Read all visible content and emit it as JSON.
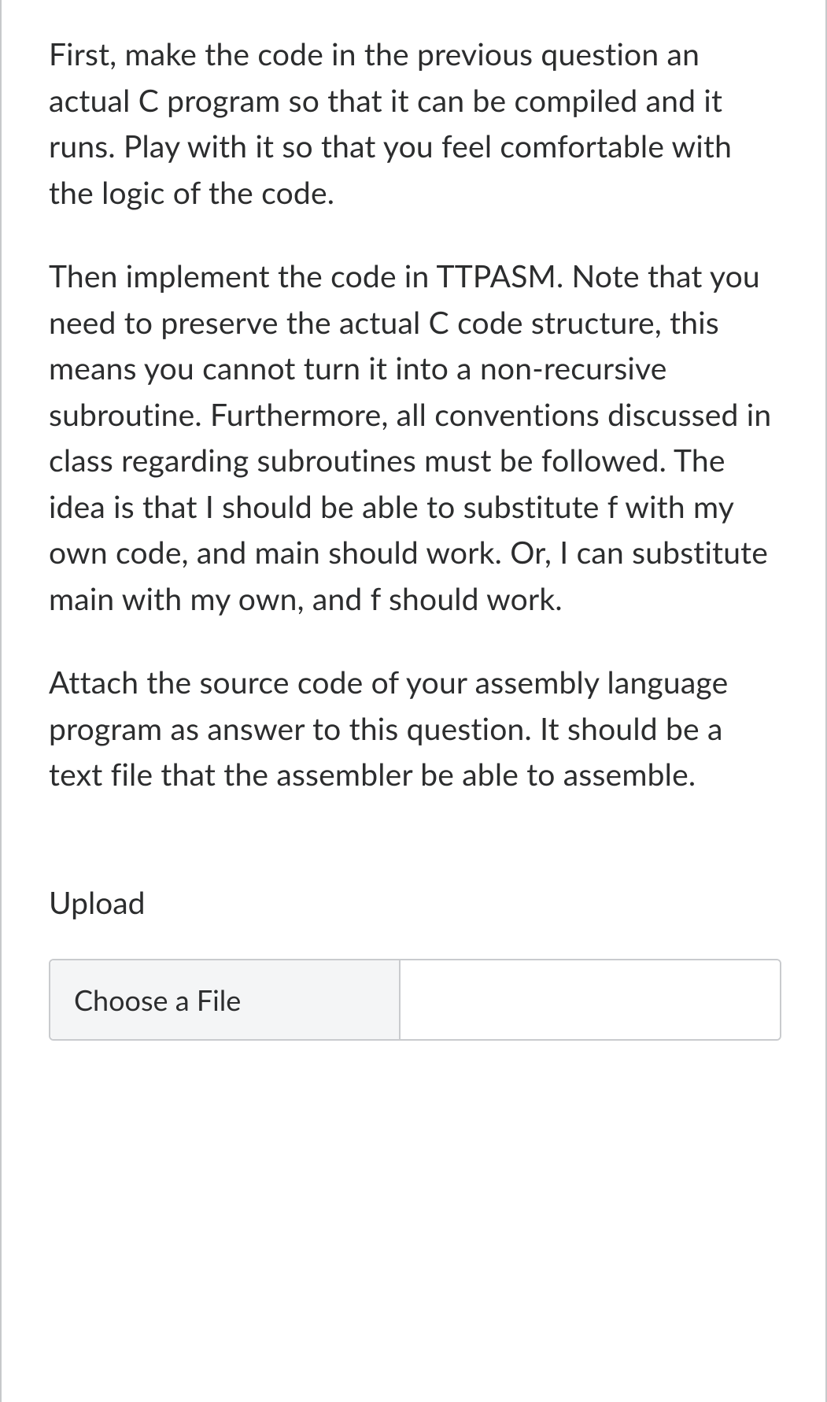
{
  "question": {
    "paragraphs": [
      "First, make the code in the previous question an actual C program so that it can be compiled and it runs. Play with it so that you feel comfortable with the logic of the code.",
      "Then implement the code in TTPASM. Note that you need to preserve the actual C code structure, this means you cannot turn it into a non-recursive subroutine. Furthermore, all conventions discussed in class regarding subroutines must be followed. The idea is that I should be able to substitute f with my own code, and main should work. Or, I can substitute main with my own, and f should work.",
      "Attach the source code of your assembly language program as answer to this question. It should be a text file that the assembler be able to assemble."
    ]
  },
  "upload": {
    "label": "Upload",
    "button_label": "Choose a File",
    "filename": ""
  }
}
